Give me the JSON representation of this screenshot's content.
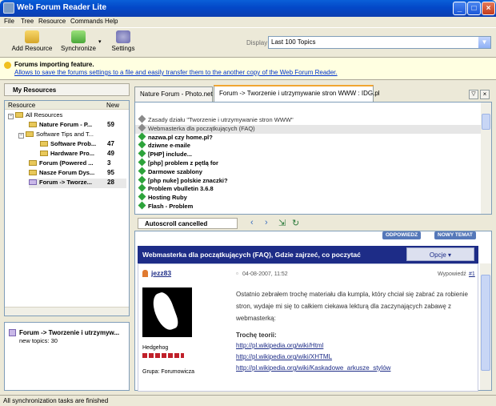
{
  "window": {
    "title": "Web Forum Reader Lite"
  },
  "menu": [
    "File",
    "Tree",
    "Resource",
    "Commands",
    "Help"
  ],
  "toolbar": {
    "add_resource": "Add Resource",
    "synchronize": "Synchronize",
    "settings": "Settings",
    "display_label": "Display:",
    "display_value": "Last 100 Topics"
  },
  "info": {
    "title": "Forums importing feature.",
    "link": "Allows to save the forums settings to a file and easily transfer them to the another copy of the Web Forum Reader."
  },
  "resources": {
    "header": "My Resources",
    "col_resource": "Resource",
    "col_new": "New",
    "items": [
      {
        "label": "All Resources",
        "count": ""
      },
      {
        "label": "Nature Forum - P...",
        "count": "59"
      },
      {
        "label": "Software Tips and T...",
        "count": ""
      },
      {
        "label": "Software Prob...",
        "count": "47"
      },
      {
        "label": "Hardware Pro...",
        "count": "49"
      },
      {
        "label": "Forum (Powered ...",
        "count": "3"
      },
      {
        "label": "Nasze Forum Dys...",
        "count": "95"
      },
      {
        "label": "Forum -> Tworze...",
        "count": "28"
      }
    ],
    "selected_title": "Forum -> Tworzenie i utrzymyw...",
    "selected_info": "new topics: 30"
  },
  "tabs": [
    {
      "label": "Nature Forum - Photo.net"
    },
    {
      "label": "Forum -> Tworzenie i utrzymywanie stron WWW : IDG.pl"
    }
  ],
  "topics": [
    {
      "label": "Zasady działu \"Tworzenie i utrzymywanie stron WWW\"",
      "state": "read"
    },
    {
      "label": "Webmasterka dla początkujących (FAQ)",
      "state": "selected"
    },
    {
      "label": "nazwa.pl czy home.pl?",
      "state": "new"
    },
    {
      "label": "dziwne e-maile",
      "state": "new"
    },
    {
      "label": "[PHP] include...",
      "state": "new"
    },
    {
      "label": "[php] problem z pętlą for",
      "state": "new"
    },
    {
      "label": "Darmowe szablony",
      "state": "new"
    },
    {
      "label": "[php nuke] polskie znaczki?",
      "state": "new"
    },
    {
      "label": "Problem vbulletin 3.6.8",
      "state": "new"
    },
    {
      "label": "Hosting Ruby",
      "state": "new"
    },
    {
      "label": "Flash - Problem",
      "state": "new"
    }
  ],
  "autoscroll": "Autoscroll cancelled",
  "post": {
    "reply_btn": "ODPOWIEDZ",
    "new_topic_btn": "NOWY TEMAT",
    "title": "Webmasterka dla początkujących (FAQ), Gdzie zajrzeć, co poczytać",
    "options": "Opcje",
    "author": "jezz83",
    "date": "04-08-2007, 11:52",
    "post_label": "Wypowiedź",
    "post_no": "#1",
    "author_title": "Hedgehog",
    "author_group": "Grupa: Forumowicza",
    "body": "Ostatnio zebrałem trochę materiału dla kumpla, który chciał się zabrać za robienie stron, wydaje mi się to całkiem ciekawa lekturą dla zaczynających zabawę z webmasterką:",
    "theory": "Trochę teorii:",
    "links": [
      "http://pl.wikipedia.org/wiki/Html",
      "http://pl.wikipedia.org/wiki/XHTML",
      "http://pl.wikipedia.org/wiki/Kaskadowe_arkusze_stylów"
    ]
  },
  "status": "All synchronization tasks are finished"
}
